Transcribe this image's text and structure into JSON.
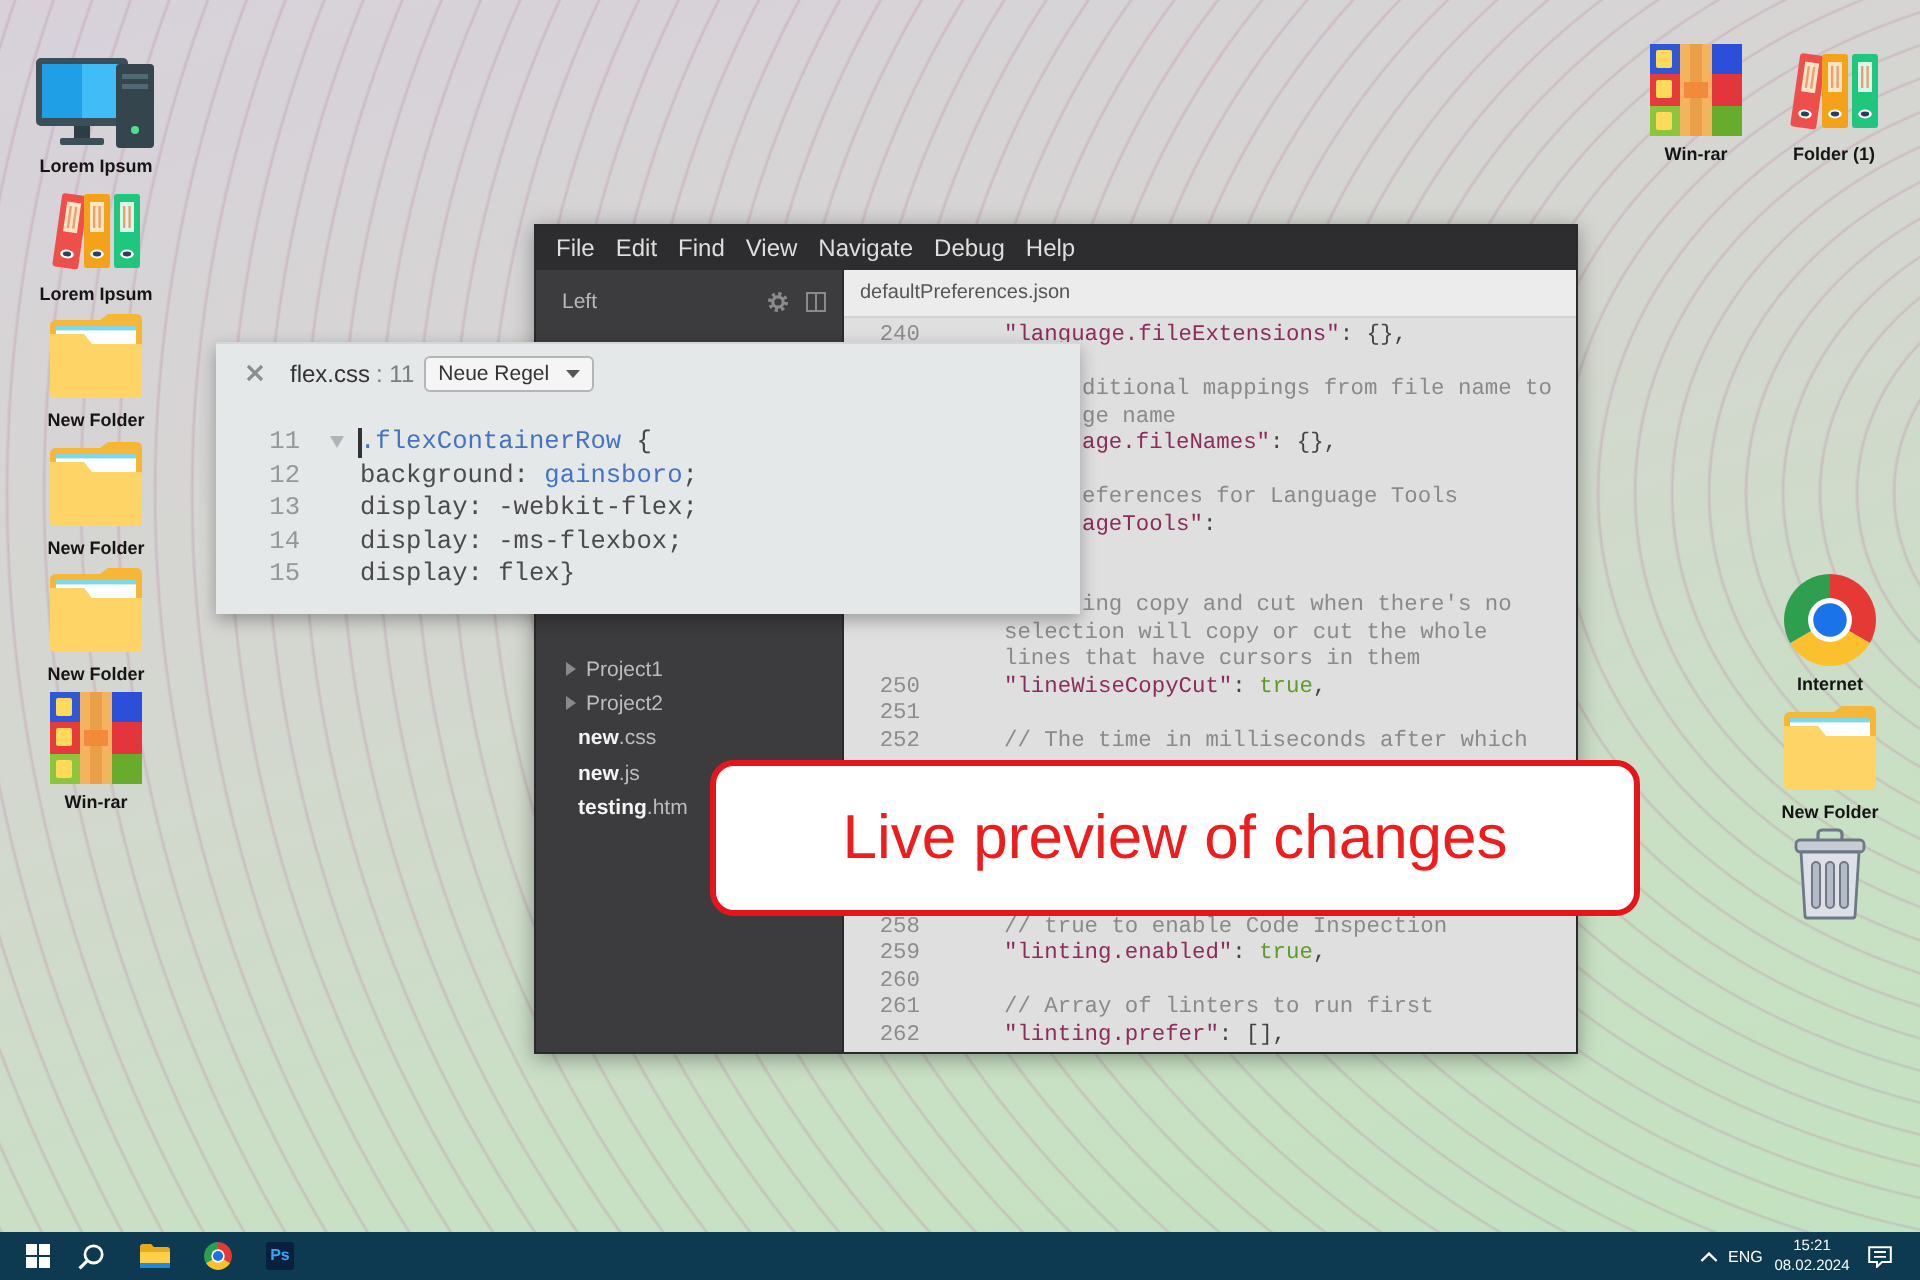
{
  "desktop": {
    "left_icons": [
      {
        "kind": "computer",
        "label": "Lorem Ipsum"
      },
      {
        "kind": "binders",
        "label": "Lorem Ipsum"
      },
      {
        "kind": "folder",
        "label": "New Folder"
      },
      {
        "kind": "folder",
        "label": "New Folder"
      },
      {
        "kind": "folder",
        "label": "New Folder"
      },
      {
        "kind": "archive",
        "label": "Win-rar"
      }
    ],
    "top_right_icons": [
      {
        "kind": "archive",
        "label": "Win-rar"
      },
      {
        "kind": "binders",
        "label": "Folder (1)"
      }
    ],
    "right_icons": [
      {
        "kind": "browser",
        "label": "Internet"
      },
      {
        "kind": "folder",
        "label": "New Folder"
      },
      {
        "kind": "trash"
      }
    ]
  },
  "editor_window": {
    "menu": [
      "File",
      "Edit",
      "Find",
      "View",
      "Navigate",
      "Debug",
      "Help"
    ],
    "sidebar": {
      "title": "Left",
      "items": [
        {
          "kind": "folder",
          "name": "Project1",
          "expanded": false
        },
        {
          "kind": "folder",
          "name": "Project2",
          "expanded": false
        },
        {
          "kind": "file",
          "name": "**new**.css"
        },
        {
          "kind": "file",
          "name": "**new**.js"
        },
        {
          "kind": "file",
          "name": "**testing**.htm"
        }
      ]
    },
    "tab": "defaultPreferences.json",
    "code_top": [
      {
        "kind": "line",
        "number": "240",
        "tokens": [
          {
            "kind": "string",
            "text": "\"language.fileExtensions\""
          },
          {
            "kind": "punct",
            "text": ": {},"
          }
        ]
      },
      {
        "kind": "blank"
      },
      {
        "kind": "partial",
        "tokens": [
          {
            "kind": "comment",
            "text": "ditional mappings from file name to"
          }
        ]
      },
      {
        "kind": "partial",
        "tokens": [
          {
            "kind": "comment",
            "text": "ge name"
          }
        ]
      },
      {
        "kind": "partial",
        "tokens": [
          {
            "kind": "string",
            "text": "age.fileNames\""
          },
          {
            "kind": "punct",
            "text": ": {},"
          }
        ]
      },
      {
        "kind": "blank"
      },
      {
        "kind": "partial",
        "tokens": [
          {
            "kind": "comment",
            "text": "eferences for Language Tools"
          }
        ]
      },
      {
        "kind": "partial",
        "tokens": [
          {
            "kind": "string",
            "text": "ageTools\""
          },
          {
            "kind": "punct",
            "text": ":"
          }
        ]
      },
      {
        "kind": "blank"
      },
      {
        "kind": "blank"
      },
      {
        "kind": "partial",
        "tokens": [
          {
            "kind": "comment",
            "text": "ing copy and cut when there's no"
          }
        ]
      },
      {
        "kind": "line",
        "tokens": [
          {
            "kind": "comment",
            "text": "selection will copy or cut the whole"
          }
        ]
      },
      {
        "kind": "line",
        "tokens": [
          {
            "kind": "comment",
            "text": "lines that have cursors in them"
          }
        ]
      },
      {
        "kind": "line",
        "number": "250",
        "tokens": [
          {
            "kind": "string",
            "text": "\"lineWiseCopyCut\""
          },
          {
            "kind": "punct",
            "text": ": "
          },
          {
            "kind": "literal",
            "text": "true"
          },
          {
            "kind": "punct",
            "text": ","
          }
        ]
      },
      {
        "kind": "line",
        "number": "251"
      },
      {
        "kind": "line",
        "number": "252",
        "tokens": [
          {
            "kind": "comment",
            "text": "// The time in milliseconds after which"
          }
        ]
      }
    ],
    "code_bottom": [
      {
        "kind": "line",
        "number": "258",
        "tokens": [
          {
            "kind": "comment",
            "text": "// true to enable Code Inspection"
          }
        ]
      },
      {
        "kind": "line",
        "number": "259",
        "tokens": [
          {
            "kind": "string",
            "text": "\"linting.enabled\""
          },
          {
            "kind": "punct",
            "text": ": "
          },
          {
            "kind": "literal",
            "text": "true"
          },
          {
            "kind": "punct",
            "text": ","
          }
        ]
      },
      {
        "kind": "line",
        "number": "260"
      },
      {
        "kind": "line",
        "number": "261",
        "tokens": [
          {
            "kind": "comment",
            "text": "// Array of linters to run first"
          }
        ]
      },
      {
        "kind": "line",
        "number": "262",
        "tokens": [
          {
            "kind": "string",
            "text": "\"linting.prefer\""
          },
          {
            "kind": "punct",
            "text": ": [],"
          }
        ]
      }
    ]
  },
  "inline_editor": {
    "file_name": "flex.css",
    "line_ref": ": 11",
    "rule_menu": "Neue Regel",
    "lines": [
      {
        "number": "11",
        "foldable": true,
        "cursor": true,
        "tokens": [
          {
            "kind": "keyword",
            "text": ".flexContainerRow"
          },
          {
            "kind": "punct",
            "text": " {"
          }
        ]
      },
      {
        "number": "12",
        "foldable": false,
        "cursor": false,
        "tokens": [
          {
            "kind": "plain",
            "text": "background: "
          },
          {
            "kind": "keyword",
            "text": "gainsboro"
          },
          {
            "kind": "plain",
            "text": ";"
          }
        ]
      },
      {
        "number": "13",
        "foldable": false,
        "cursor": false,
        "tokens": [
          {
            "kind": "plain",
            "text": "display: -webkit-flex;"
          }
        ]
      },
      {
        "number": "14",
        "foldable": false,
        "cursor": false,
        "tokens": [
          {
            "kind": "plain",
            "text": "display: -ms-flexbox;"
          }
        ]
      },
      {
        "number": "15",
        "foldable": false,
        "cursor": false,
        "tokens": [
          {
            "kind": "plain",
            "text": "display: flex}"
          }
        ]
      }
    ]
  },
  "callout": {
    "text": "Live preview of changes"
  },
  "taskbar": {
    "apps": [
      {
        "kind": "start"
      },
      {
        "kind": "search"
      },
      {
        "kind": "folder"
      },
      {
        "kind": "browser"
      },
      {
        "kind": "tile",
        "label": "Ps"
      }
    ],
    "language": "ENG",
    "time": "15:21",
    "date": "08.02.2024"
  }
}
